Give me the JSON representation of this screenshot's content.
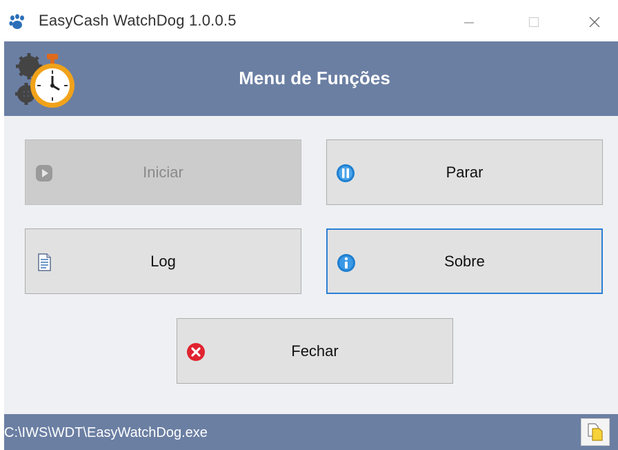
{
  "window": {
    "title": "EasyCash WatchDog 1.0.0.5",
    "icons": {
      "app": "paw-icon",
      "minimize": "minimize-icon",
      "maximize": "maximize-icon",
      "close": "close-icon"
    }
  },
  "header": {
    "title": "Menu de Funções",
    "icon": "stopwatch-gears-icon"
  },
  "buttons": {
    "iniciar": {
      "label": "Iniciar",
      "icon": "play-icon",
      "state": "disabled"
    },
    "parar": {
      "label": "Parar",
      "icon": "pause-icon",
      "state": "normal"
    },
    "log": {
      "label": "Log",
      "icon": "document-icon",
      "state": "normal"
    },
    "sobre": {
      "label": "Sobre",
      "icon": "info-icon",
      "state": "focused"
    },
    "fechar": {
      "label": "Fechar",
      "icon": "close-circle-icon",
      "state": "normal"
    }
  },
  "statusbar": {
    "path": "C:\\IWS\\WDT\\EasyWatchDog.exe",
    "copy_icon": "copy-icon"
  },
  "colors": {
    "header_bg": "#6b7fa3",
    "main_bg": "#eff0f3",
    "button_bg": "#e1e1e1",
    "focus_border": "#2a7fd4",
    "close_red": "#e0232f",
    "info_blue": "#1e7fd0"
  }
}
